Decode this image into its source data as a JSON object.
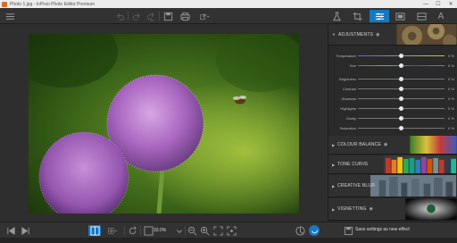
{
  "window": {
    "title": "Photo 1.jpg - InPixio Photo Editor Premium",
    "controls": [
      "—",
      "☐",
      "✕"
    ]
  },
  "toolbar": {
    "icons": [
      "menu-icon",
      "undo-icon",
      "redo-icon",
      "redo-all-icon",
      "save-icon",
      "print-icon",
      "share-icon"
    ],
    "right_tabs": [
      "effects-icon",
      "crop-icon",
      "adjustments-icon",
      "frames-icon",
      "overlay-icon",
      "text-icon"
    ]
  },
  "panel": {
    "adjustments": {
      "title": "ADJUSTMENTS",
      "rows": [
        {
          "label": "Temperature",
          "value": "0 %",
          "position": 0.5
        },
        {
          "label": "Hue",
          "value": "0 %",
          "position": 0.5
        },
        {
          "label": "Brightness",
          "value": "0 %",
          "position": 0.5
        },
        {
          "label": "Contrast",
          "value": "0 %",
          "position": 0.5
        },
        {
          "label": "Shadows",
          "value": "0 %",
          "position": 0.5
        },
        {
          "label": "Highlights",
          "value": "0 %",
          "position": 0.5
        },
        {
          "label": "Clarity",
          "value": "0 %",
          "position": 0.5
        },
        {
          "label": "Saturation",
          "value": "0 %",
          "position": 0.5
        }
      ]
    },
    "sections": [
      {
        "title": "COLOUR BALANCE"
      },
      {
        "title": "TONE CURVE"
      },
      {
        "title": "CREATIVE BLUR"
      },
      {
        "title": "VIGNETTING"
      }
    ]
  },
  "bottombar": {
    "zoom": "33.0%",
    "save_effect": "Save settings as new effect"
  },
  "colors": {
    "accent": "#1478c4",
    "panel_bg": "#2a2a2a",
    "toolbar_bg": "#323232"
  }
}
